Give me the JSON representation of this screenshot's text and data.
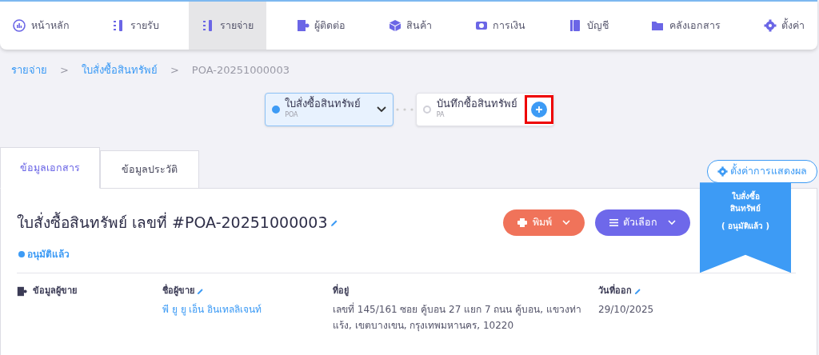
{
  "nav": [
    {
      "label": "หน้าหลัก",
      "selected": false
    },
    {
      "label": "รายรับ",
      "selected": false
    },
    {
      "label": "รายจ่าย",
      "selected": true
    },
    {
      "label": "ผู้ติดต่อ",
      "selected": false
    },
    {
      "label": "สินค้า",
      "selected": false
    },
    {
      "label": "การเงิน",
      "selected": false
    },
    {
      "label": "บัญชี",
      "selected": false
    },
    {
      "label": "คลังเอกสาร",
      "selected": false
    },
    {
      "label": "ตั้งค่า",
      "selected": false
    }
  ],
  "breadcrumb": [
    {
      "label": "รายจ่าย",
      "kind": "link"
    },
    {
      "label": ">",
      "kind": "separator"
    },
    {
      "label": "ใบสั่งซื้อสินทรัพย์",
      "kind": "link"
    },
    {
      "label": ">",
      "kind": "separator"
    },
    {
      "label": "POA-20251000003",
      "kind": "current"
    }
  ],
  "steps": [
    {
      "title": "ใบสั่งซื้อสินทรัพย์",
      "code": "POA",
      "selected": true
    },
    {
      "title": "บันทึกซื้อสินทรัพย์",
      "code": "PA",
      "selected": false
    }
  ],
  "tabs": [
    {
      "label": "ข้อมูลเอกสาร",
      "selected": true
    },
    {
      "label": "ข้อมูลประวัติ",
      "selected": false
    }
  ],
  "display_settings_button": "ตั้งค่าการแสดงผล",
  "ribbon": {
    "title_lines": [
      "ใบสั่งซื้อ",
      "สินทรัพย์"
    ],
    "status": "( อนุมัติแล้ว )"
  },
  "document": {
    "title": "ใบสั่งซื้อสินทรัพย์ เลขที่ #POA-20251000003",
    "print_button": "พิมพ์",
    "options_button": "ตัวเลือก",
    "status": {
      "label": "อนุมัติแล้ว",
      "color": "#3d9bf5"
    }
  },
  "vendor": {
    "section": "ข้อมูลผู้ขาย",
    "fields": [
      {
        "label": "ชื่อผู้ขาย",
        "editable": true,
        "kind": "link",
        "value": "พี ยู ยู เอ็น อินเทลลิเจนท์"
      },
      {
        "label": "ที่อยู่",
        "editable": false,
        "kind": "text",
        "value": "เลขที่ 145/161 ซอย คู้บอน 27 แยก 7 ถนน คู้บอน, แขวงท่าแร้ง, เขตบางเขน, กรุงเทพมหานคร, 10220"
      },
      {
        "label": "วันที่ออก",
        "editable": true,
        "kind": "text",
        "value": "29/10/2025"
      }
    ]
  }
}
